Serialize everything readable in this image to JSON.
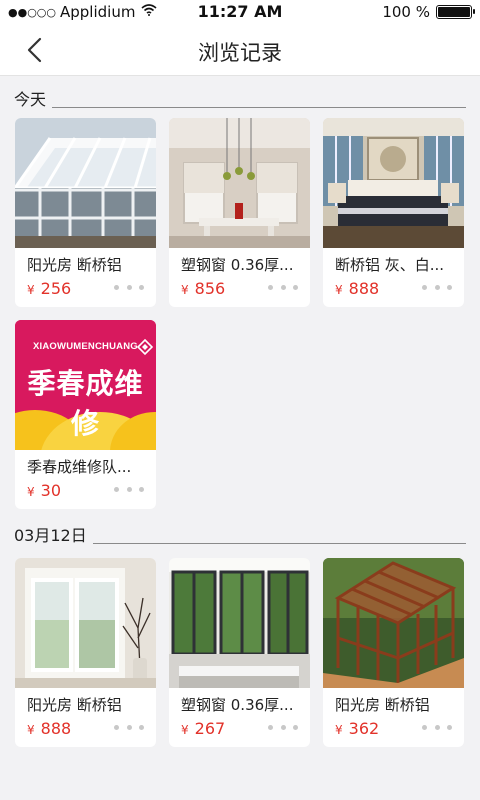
{
  "status_bar": {
    "carrier": "Applidium",
    "signal_dots": "●●○○○",
    "time": "11:27 AM",
    "battery_percent": "100 %",
    "battery_level": 1.0
  },
  "nav": {
    "title": "浏览记录"
  },
  "sections": [
    {
      "label": "今天",
      "items": [
        {
          "name": "阳光房 断桥铝",
          "currency": "¥",
          "price": "256"
        },
        {
          "name": "塑钢窗 0.36厚...",
          "currency": "¥",
          "price": "856"
        },
        {
          "name": "断桥铝 灰、白...",
          "currency": "¥",
          "price": "888"
        },
        {
          "name": "季春成维修队...",
          "currency": "¥",
          "price": "30",
          "logo_text_top": "XIAOWUMENCHUANG",
          "logo_text_main": "季春成维修"
        }
      ]
    },
    {
      "label": "03月12日",
      "items": [
        {
          "name": "阳光房 断桥铝",
          "currency": "¥",
          "price": "888"
        },
        {
          "name": "塑钢窗 0.36厚...",
          "currency": "¥",
          "price": "267"
        },
        {
          "name": "阳光房 断桥铝",
          "currency": "¥",
          "price": "362"
        }
      ]
    }
  ],
  "colors": {
    "price": "#e2322a",
    "background": "#f2f2f4",
    "logo_pink": "#d8195e",
    "logo_yellow": "#f6c21c"
  }
}
